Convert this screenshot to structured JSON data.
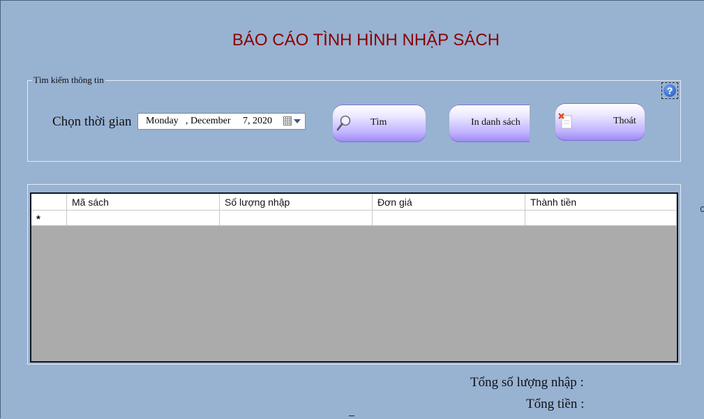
{
  "title": "BÁO CÁO TÌNH HÌNH NHẬP SÁCH",
  "search_group": {
    "label": "Tìm kiếm thông tin",
    "time_label": "Chọn thời gian",
    "date": {
      "weekday": "Monday",
      "month": ", December",
      "day_year": "7, 2020"
    }
  },
  "buttons": {
    "search": "Tìm",
    "print": "In danh sách",
    "exit": "Thoát",
    "help": "?"
  },
  "grid": {
    "columns": [
      "Mã sách",
      "Số lượng nhập",
      "Đơn giá",
      "Thành tiền"
    ],
    "new_row_marker": "*"
  },
  "totals": {
    "quantity_label": "Tổng số lượng nhập :",
    "amount_label": "Tổng tiền :"
  }
}
